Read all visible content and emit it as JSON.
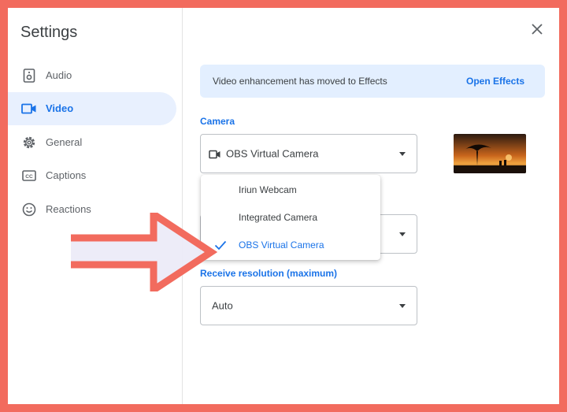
{
  "settings": {
    "title": "Settings",
    "nav": [
      {
        "label": "Audio",
        "icon": "speaker-icon"
      },
      {
        "label": "Video",
        "icon": "video-camera-icon",
        "active": true
      },
      {
        "label": "General",
        "icon": "gear-icon"
      },
      {
        "label": "Captions",
        "icon": "captions-icon"
      },
      {
        "label": "Reactions",
        "icon": "smiley-icon"
      }
    ]
  },
  "banner": {
    "text": "Video enhancement has moved to Effects",
    "link": "Open Effects"
  },
  "camera": {
    "label": "Camera",
    "selected": "OBS Virtual Camera",
    "options": [
      "Iriun Webcam",
      "Integrated Camera",
      "OBS Virtual Camera"
    ],
    "selected_index": 2
  },
  "receive_resolution": {
    "label": "Receive resolution (maximum)",
    "value": "Auto"
  },
  "colors": {
    "accent": "#1a73e8",
    "frame": "#f26b5e",
    "active_nav_bg": "#e8f0fe",
    "banner_bg": "#e3efff"
  }
}
